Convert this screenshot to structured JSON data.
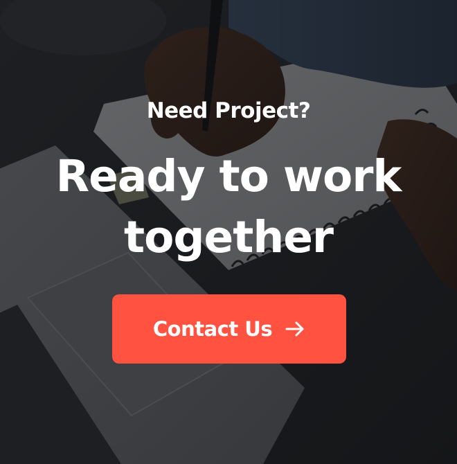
{
  "cta": {
    "eyebrow": "Need Project?",
    "headline_line1": "Ready to work",
    "headline_line2": "together",
    "button_label": "Contact Us",
    "button_icon": "arrow-right-icon",
    "button_color": "#ff5241",
    "text_color": "#ffffff"
  },
  "background": {
    "image_icon": "writing-notebook-laptop-photo"
  }
}
